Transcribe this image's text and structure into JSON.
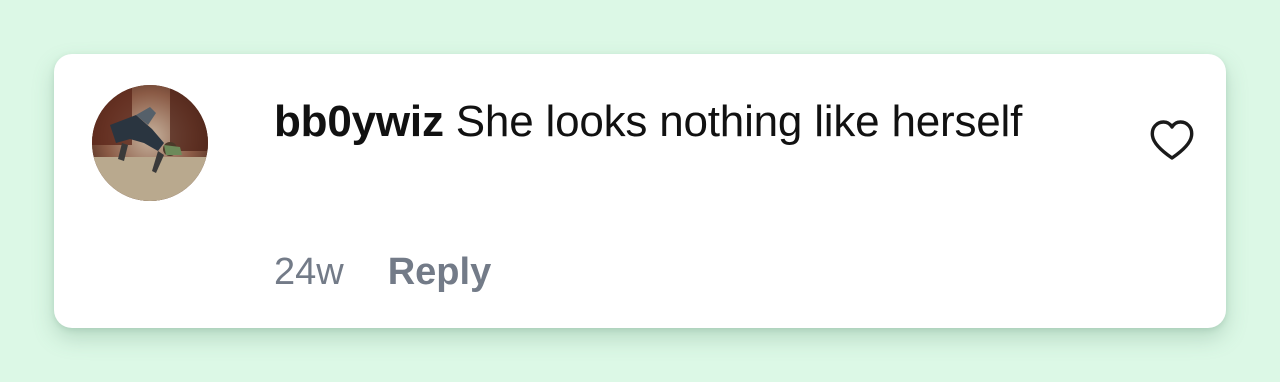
{
  "comment": {
    "username": "bb0ywiz",
    "text": "She looks nothing like herself",
    "timestamp": "24w",
    "reply_label": "Reply",
    "like_icon": "heart-outline-icon"
  },
  "colors": {
    "background": "#dcf8e6",
    "card": "#ffffff",
    "text": "#111111",
    "meta": "#737b88"
  }
}
